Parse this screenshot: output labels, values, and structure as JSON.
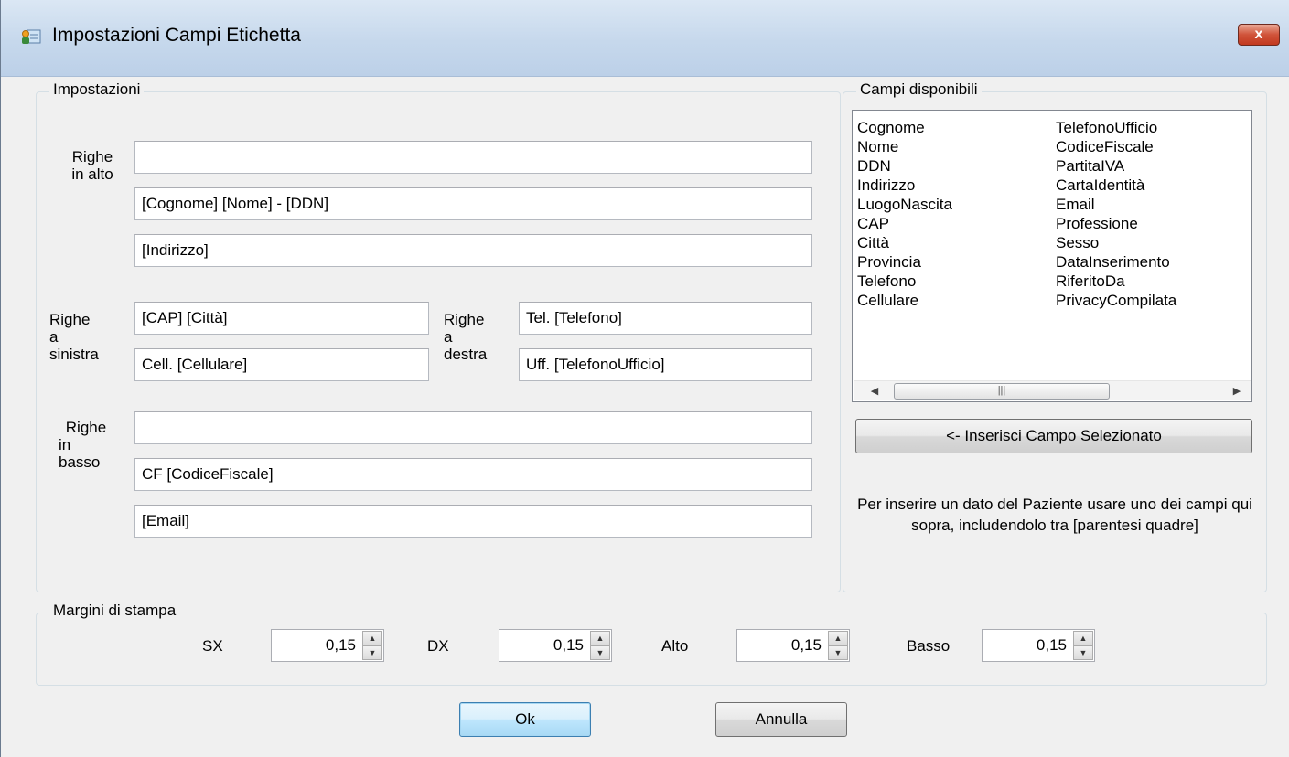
{
  "window": {
    "title": "Impostazioni Campi Etichetta",
    "close_label": "x"
  },
  "settings": {
    "legend": "Impostazioni",
    "top": {
      "label_lines": [
        "Righe",
        "in alto"
      ],
      "values": [
        "",
        "[Cognome] [Nome] - [DDN]",
        "[Indirizzo]"
      ]
    },
    "left": {
      "label_lines": [
        "Righe",
        "a",
        "sinistra"
      ],
      "values": [
        "[CAP] [Città]",
        "Cell. [Cellulare]"
      ]
    },
    "right": {
      "label_lines": [
        "Righe",
        "a",
        "destra"
      ],
      "values": [
        "Tel. [Telefono]",
        "Uff. [TelefonoUfficio]"
      ]
    },
    "bottom": {
      "label_lines": [
        "Righe",
        "in",
        "basso"
      ],
      "values": [
        "",
        "CF [CodiceFiscale]",
        "[Email]"
      ]
    }
  },
  "fields": {
    "legend": "Campi disponibili",
    "col1": [
      "Cognome",
      "Nome",
      "DDN",
      "Indirizzo",
      "LuogoNascita",
      "CAP",
      "Città",
      "Provincia",
      "Telefono",
      "Cellulare"
    ],
    "col2": [
      "TelefonoUfficio",
      "CodiceFiscale",
      "PartitaIVA",
      "CartaIdentità",
      "Email",
      "Professione",
      "Sesso",
      "DataInserimento",
      "RiferitoDa",
      "PrivacyCompilata"
    ],
    "insert_button": "<- Inserisci Campo Selezionato",
    "note": "Per inserire un dato del Paziente usare uno dei campi qui sopra, includendolo tra [parentesi quadre]"
  },
  "margins": {
    "legend": "Margini di stampa",
    "sx_label": "SX",
    "sx_value": "0,15",
    "dx_label": "DX",
    "dx_value": "0,15",
    "alto_label": "Alto",
    "alto_value": "0,15",
    "basso_label": "Basso",
    "basso_value": "0,15"
  },
  "buttons": {
    "ok": "Ok",
    "cancel": "Annulla"
  }
}
